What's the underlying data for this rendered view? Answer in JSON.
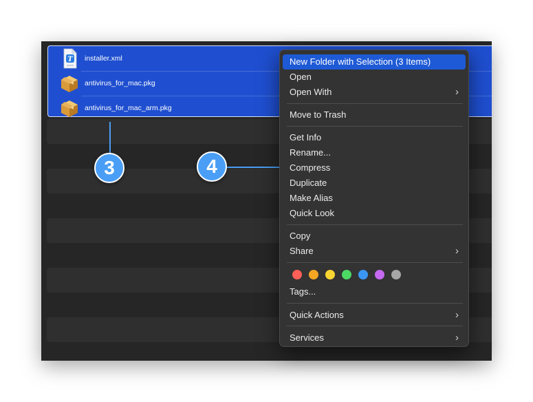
{
  "files": [
    {
      "name": "installer.xml",
      "icon": "xml-document-icon"
    },
    {
      "name": "antivirus_for_mac.pkg",
      "icon": "package-icon"
    },
    {
      "name": "antivirus_for_mac_arm.pkg",
      "icon": "package-icon"
    }
  ],
  "callouts": {
    "left": "3",
    "right": "4"
  },
  "menu": {
    "new_folder": "New Folder with Selection (3 Items)",
    "open": "Open",
    "open_with": "Open With",
    "move_to_trash": "Move to Trash",
    "get_info": "Get Info",
    "rename": "Rename...",
    "compress": "Compress",
    "duplicate": "Duplicate",
    "make_alias": "Make Alias",
    "quick_look": "Quick Look",
    "copy": "Copy",
    "share": "Share",
    "tags": "Tags...",
    "quick_actions": "Quick Actions",
    "services": "Services"
  },
  "tag_colors": [
    "#fe5f57",
    "#f6a623",
    "#f8d531",
    "#4cd964",
    "#3a97f5",
    "#c569f2",
    "#a6a6a6"
  ],
  "colors": {
    "selection": "#1f4fd0",
    "highlight": "#1e5ad6",
    "callout": "#4a9ef5"
  }
}
